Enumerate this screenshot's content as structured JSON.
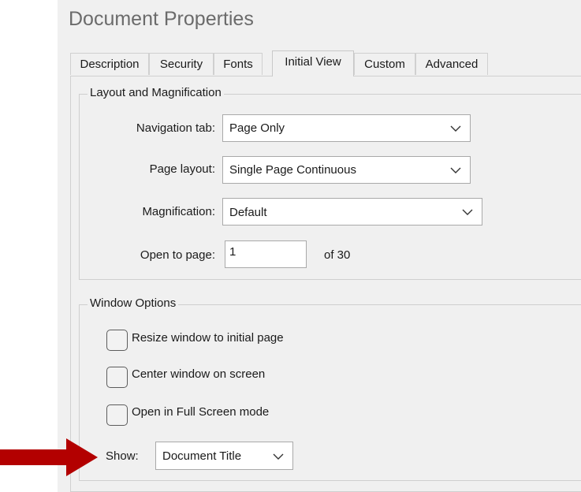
{
  "dialog": {
    "title": "Document Properties"
  },
  "tabs": [
    {
      "label": "Description",
      "active": false
    },
    {
      "label": "Security",
      "active": false
    },
    {
      "label": "Fonts",
      "active": false
    },
    {
      "label": "Initial View",
      "active": true
    },
    {
      "label": "Custom",
      "active": false
    },
    {
      "label": "Advanced",
      "active": false
    }
  ],
  "layout_group": {
    "title": "Layout and Magnification",
    "navigation_tab": {
      "label": "Navigation tab:",
      "value": "Page Only"
    },
    "page_layout": {
      "label": "Page layout:",
      "value": "Single Page Continuous"
    },
    "magnification": {
      "label": "Magnification:",
      "value": "Default"
    },
    "open_to_page": {
      "label": "Open to page:",
      "value": "1",
      "suffix": "of 30"
    }
  },
  "window_group": {
    "title": "Window Options",
    "options": [
      {
        "label": "Resize window to initial page",
        "checked": false
      },
      {
        "label": "Center window on screen",
        "checked": false
      },
      {
        "label": "Open in Full Screen mode",
        "checked": false
      }
    ],
    "show": {
      "label": "Show:",
      "value": "Document Title"
    }
  },
  "annotation": {
    "arrow_color": "#b30000"
  },
  "icons": {
    "dropdown": "chevron-down-icon",
    "pointer": "arrow-right-icon"
  }
}
